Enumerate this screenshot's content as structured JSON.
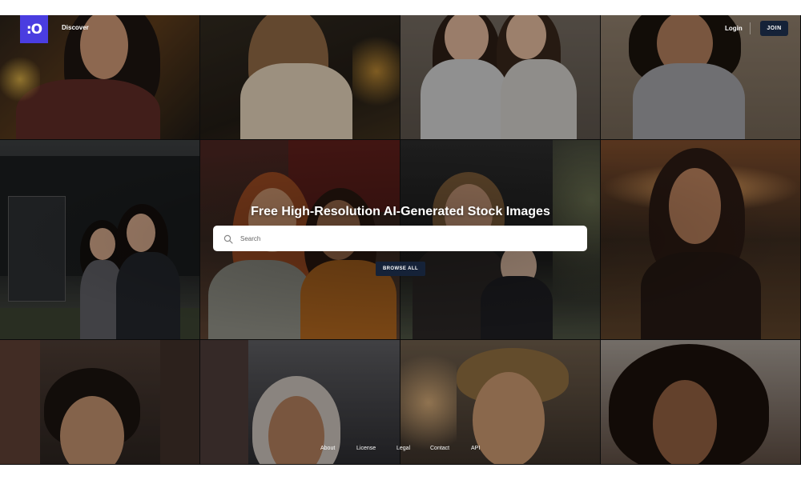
{
  "header": {
    "logo_text": ":O",
    "nav_discover": "Discover",
    "nav_login": "Login",
    "join_label": "JOIN"
  },
  "hero": {
    "title": "Free High-Resolution AI-Generated Stock Images",
    "search_placeholder": "Search",
    "browse_label": "BROWSE ALL"
  },
  "footer": {
    "links": [
      "About",
      "License",
      "Legal",
      "Contact",
      "API"
    ]
  },
  "colors": {
    "brand": "#4a3de0",
    "button_dark": "#152238"
  },
  "icons": {
    "search": "search-icon"
  }
}
